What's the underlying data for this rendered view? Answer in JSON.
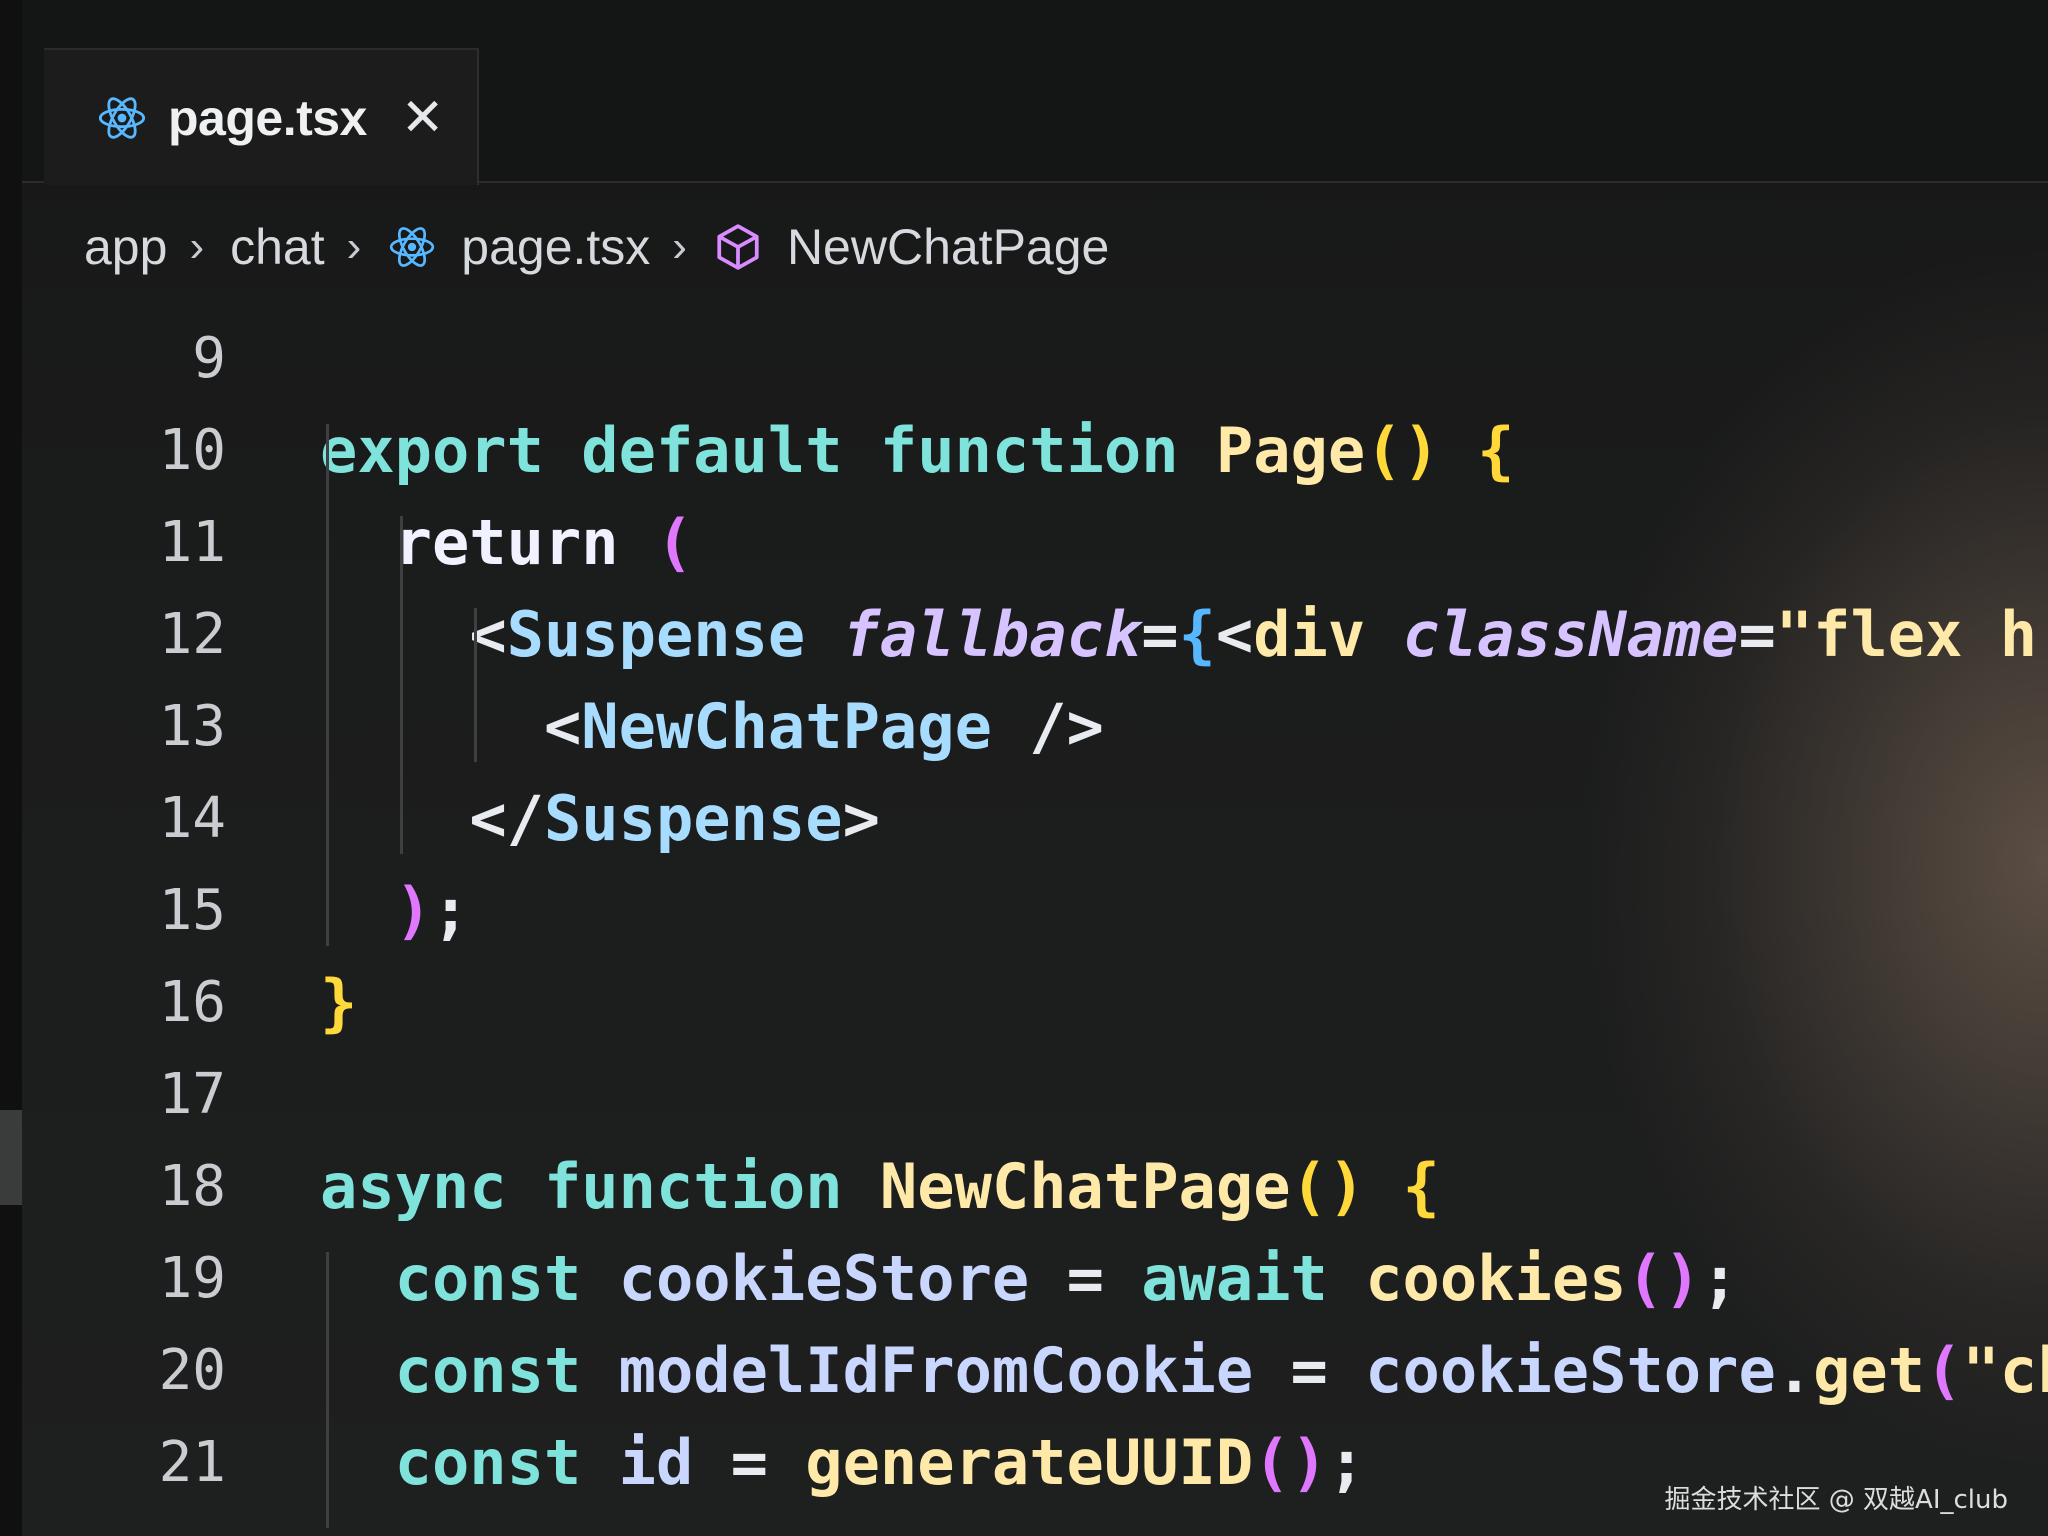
{
  "editor": {
    "tab": {
      "label": "page.tsx",
      "close_glyph": "✕",
      "icon": "react-icon"
    },
    "breadcrumb": [
      {
        "label": "app"
      },
      {
        "label": "chat"
      },
      {
        "label": "page.tsx",
        "icon": "react-icon"
      },
      {
        "label": "NewChatPage",
        "icon": "component-cube-icon"
      }
    ],
    "breadcrumb_separator": "›",
    "lines": [
      {
        "num": "9",
        "tokens": []
      },
      {
        "num": "10",
        "tokens": [
          {
            "t": "export",
            "c": "kw"
          },
          {
            "t": " "
          },
          {
            "t": "default",
            "c": "kw"
          },
          {
            "t": " "
          },
          {
            "t": "function",
            "c": "kw"
          },
          {
            "t": " "
          },
          {
            "t": "Page",
            "c": "fn"
          },
          {
            "t": "()",
            "c": "br1"
          },
          {
            "t": " "
          },
          {
            "t": "{",
            "c": "br1"
          }
        ]
      },
      {
        "num": "11",
        "tokens": [
          {
            "t": "  "
          },
          {
            "t": "return",
            "c": "kw2"
          },
          {
            "t": " "
          },
          {
            "t": "(",
            "c": "br2"
          }
        ]
      },
      {
        "num": "12",
        "tokens": [
          {
            "t": "    "
          },
          {
            "t": "<",
            "c": "punc"
          },
          {
            "t": "Suspense",
            "c": "tag"
          },
          {
            "t": " "
          },
          {
            "t": "fallback",
            "c": "attr"
          },
          {
            "t": "=",
            "c": "punc"
          },
          {
            "t": "{",
            "c": "br3"
          },
          {
            "t": "<",
            "c": "punc"
          },
          {
            "t": "div",
            "c": "str"
          },
          {
            "t": " "
          },
          {
            "t": "className",
            "c": "attr"
          },
          {
            "t": "=",
            "c": "punc"
          },
          {
            "t": "\"flex h",
            "c": "str"
          }
        ]
      },
      {
        "num": "13",
        "tokens": [
          {
            "t": "      "
          },
          {
            "t": "<",
            "c": "punc"
          },
          {
            "t": "NewChatPage",
            "c": "tag"
          },
          {
            "t": " "
          },
          {
            "t": "/>",
            "c": "punc"
          }
        ]
      },
      {
        "num": "14",
        "tokens": [
          {
            "t": "    "
          },
          {
            "t": "</",
            "c": "punc"
          },
          {
            "t": "Suspense",
            "c": "tag"
          },
          {
            "t": ">",
            "c": "punc"
          }
        ]
      },
      {
        "num": "15",
        "tokens": [
          {
            "t": "  "
          },
          {
            "t": ")",
            "c": "br2"
          },
          {
            "t": ";",
            "c": "punc"
          }
        ]
      },
      {
        "num": "16",
        "tokens": [
          {
            "t": "}",
            "c": "br1"
          }
        ]
      },
      {
        "num": "17",
        "tokens": []
      },
      {
        "num": "18",
        "tokens": [
          {
            "t": "async",
            "c": "kw"
          },
          {
            "t": " "
          },
          {
            "t": "function",
            "c": "kw"
          },
          {
            "t": " "
          },
          {
            "t": "NewChatPage",
            "c": "fn"
          },
          {
            "t": "()",
            "c": "br1"
          },
          {
            "t": " "
          },
          {
            "t": "{",
            "c": "br1"
          }
        ]
      },
      {
        "num": "19",
        "tokens": [
          {
            "t": "  "
          },
          {
            "t": "const",
            "c": "kw"
          },
          {
            "t": " "
          },
          {
            "t": "cookieStore",
            "c": "var"
          },
          {
            "t": " "
          },
          {
            "t": "=",
            "c": "punc"
          },
          {
            "t": " "
          },
          {
            "t": "await",
            "c": "kw"
          },
          {
            "t": " "
          },
          {
            "t": "cookies",
            "c": "fn"
          },
          {
            "t": "()",
            "c": "br2"
          },
          {
            "t": ";",
            "c": "punc"
          }
        ]
      },
      {
        "num": "20",
        "tokens": [
          {
            "t": "  "
          },
          {
            "t": "const",
            "c": "kw"
          },
          {
            "t": " "
          },
          {
            "t": "modelIdFromCookie",
            "c": "var"
          },
          {
            "t": " "
          },
          {
            "t": "=",
            "c": "punc"
          },
          {
            "t": " "
          },
          {
            "t": "cookieStore",
            "c": "var"
          },
          {
            "t": ".",
            "c": "punc"
          },
          {
            "t": "get",
            "c": "fn"
          },
          {
            "t": "(",
            "c": "br2"
          },
          {
            "t": "\"ch",
            "c": "str"
          }
        ]
      },
      {
        "num": "21",
        "tokens": [
          {
            "t": "  "
          },
          {
            "t": "const",
            "c": "kw"
          },
          {
            "t": " "
          },
          {
            "t": "id",
            "c": "var"
          },
          {
            "t": " "
          },
          {
            "t": "=",
            "c": "punc"
          },
          {
            "t": " "
          },
          {
            "t": "generateUUID",
            "c": "fn"
          },
          {
            "t": "()",
            "c": "br2"
          },
          {
            "t": ";",
            "c": "punc"
          }
        ]
      }
    ]
  },
  "watermark": "掘金技术社区 @ 双越AI_club"
}
